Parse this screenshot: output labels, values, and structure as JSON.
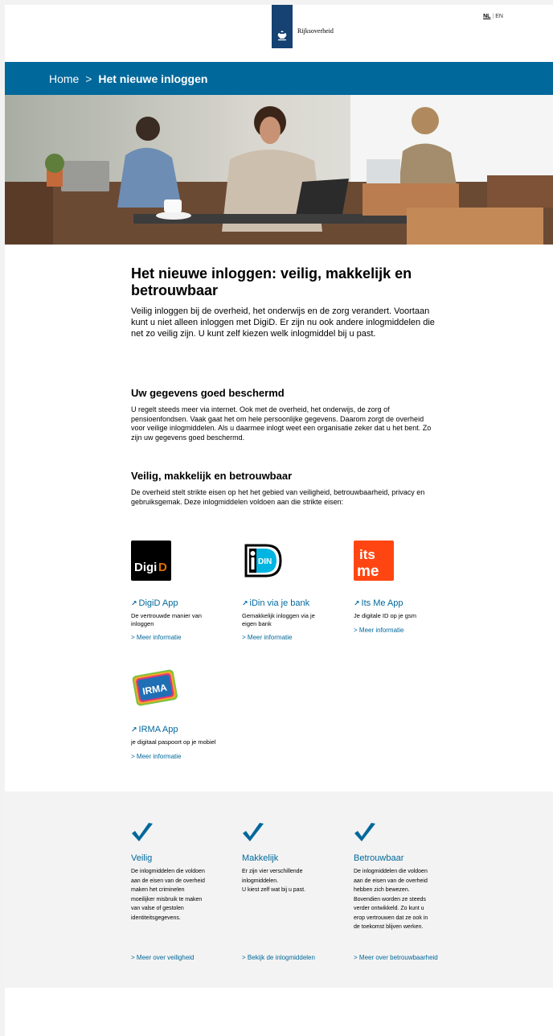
{
  "header": {
    "logo_text": "Rijksoverheid",
    "lang_nl": "NL",
    "lang_sep": "|",
    "lang_en": "EN"
  },
  "breadcrumb": {
    "home": "Home",
    "separator": ">",
    "current": "Het nieuwe inloggen"
  },
  "intro": {
    "title": "Het nieuwe inloggen: veilig, makkelijk en betrouwbaar",
    "text": "Veilig inloggen bij de overheid, het onderwijs en de zorg verandert. Voortaan kunt u niet alleen inloggen met DigiD. Er zijn nu ook andere inlogmiddelen die net zo veilig zijn. U kunt zelf kiezen welk inlogmiddel bij u past."
  },
  "section1": {
    "heading": "Uw gegevens goed beschermd",
    "text": "U regelt steeds meer via internet. Ook met de overheid, het onderwijs, de zorg of pensioenfondsen. Vaak gaat het om hele persoonlijke gegevens. Daarom zorgt de overheid voor veilige inlogmiddelen. Als u daarmee inlogt weet een organisatie zeker dat u het bent. Zo zijn uw gegevens goed beschermd."
  },
  "section2": {
    "heading": "Veilig, makkelijk en betrouwbaar",
    "text": "De overheid stelt strikte eisen op het het gebied van veiligheid, betrouwbaarheid, privacy en gebruiksgemak. Deze inlogmiddelen voldoen aan die strikte eisen:"
  },
  "apps": [
    {
      "logo": "Digi D",
      "title": "DigiD App",
      "desc": "De vertrouwde manier van inloggen",
      "more": "Meer informatie"
    },
    {
      "logo": "iDIN",
      "title": "iDin via je bank",
      "desc": "Gemakkelijk inloggen via je eigen bank",
      "more": "Meer informatie"
    },
    {
      "logo": "its me",
      "title": "Its Me App",
      "desc": "Je digitale ID op je gsm",
      "more": "Meer informatie"
    },
    {
      "logo": "IRMA",
      "title": "IRMA App",
      "desc": "je digitaal paspoort op je mobiel",
      "more": "Meer informatie"
    }
  ],
  "features": [
    {
      "title": "Veilig",
      "desc": "De inlogmiddelen die voldoen\naan de eisen van de overheid\nmaken het criminelen\nmoeilijker misbruik te maken\nvan valse of gestolen\nidentiteitsgegevens.",
      "more": "Meer over veiligheid"
    },
    {
      "title": "Makkelijk",
      "desc": "Er zijn vier verschillende\ninlogmiddelen.\nU kiest zelf wat bij u past.",
      "more": "Bekijk de inlogmiddelen"
    },
    {
      "title": "Betrouwbaar",
      "desc": "De inlogmiddelen die voldoen\naan de eisen van de overheid\nhebben zich bewezen.\nBovendien worden ze steeds\nverder ontwikkeld. Zo kunt u\nerop vertrouwen dat ze ook in\nde toekomst blijven werken.",
      "more": "Meer over betrouwbaarheid"
    }
  ],
  "colors": {
    "brand_blue": "#01689b",
    "logo_navy": "#154273",
    "band_grey": "#f3f3f3"
  },
  "icons": [
    "crest-icon",
    "arrow-upright-icon",
    "chevron-right-icon",
    "checkmark-icon"
  ]
}
